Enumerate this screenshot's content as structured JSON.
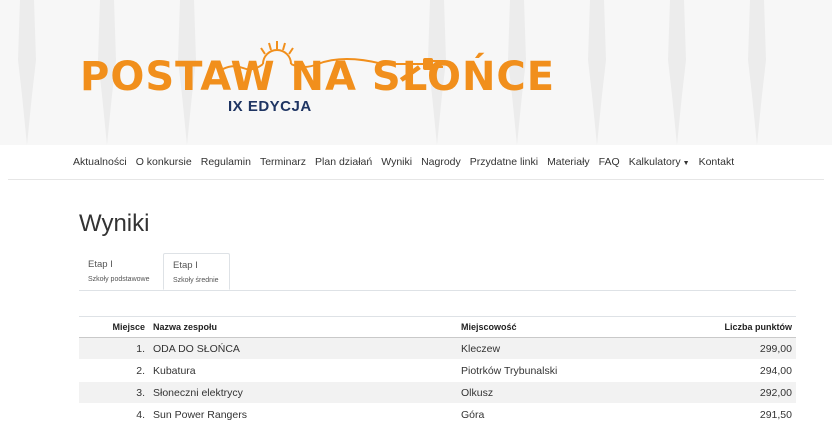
{
  "header": {
    "logo_title": "POSTAW NA SŁOŃCE",
    "logo_subtitle": "IX EDYCJA",
    "brand_orange": "#f18f1c",
    "brand_navy": "#1f3563"
  },
  "nav": {
    "items": [
      {
        "label": "Aktualności"
      },
      {
        "label": "O konkursie"
      },
      {
        "label": "Regulamin"
      },
      {
        "label": "Terminarz"
      },
      {
        "label": "Plan działań"
      },
      {
        "label": "Wyniki"
      },
      {
        "label": "Nagrody"
      },
      {
        "label": "Przydatne linki"
      },
      {
        "label": "Materiały"
      },
      {
        "label": "FAQ"
      },
      {
        "label": "Kalkulatory",
        "dropdown": true
      },
      {
        "label": "Kontakt"
      }
    ]
  },
  "page": {
    "title": "Wyniki"
  },
  "tabs": [
    {
      "title": "Etap I",
      "subtitle": "Szkoły podstawowe",
      "active": false
    },
    {
      "title": "Etap I",
      "subtitle": "Szkoły średnie",
      "active": true
    }
  ],
  "table": {
    "headers": {
      "place": "Miejsce",
      "team": "Nazwa zespołu",
      "city": "Miejscowość",
      "points": "Liczba punktów"
    },
    "rows": [
      {
        "place": "1.",
        "team": "ODA DO SŁOŃCA",
        "city": "Kleczew",
        "points": "299,00"
      },
      {
        "place": "2.",
        "team": "Kubatura",
        "city": "Piotrków Trybunalski",
        "points": "294,00"
      },
      {
        "place": "3.",
        "team": "Słoneczni elektrycy",
        "city": "Olkusz",
        "points": "292,00"
      },
      {
        "place": "4.",
        "team": "Sun Power Rangers",
        "city": "Góra",
        "points": "291,50"
      }
    ]
  }
}
